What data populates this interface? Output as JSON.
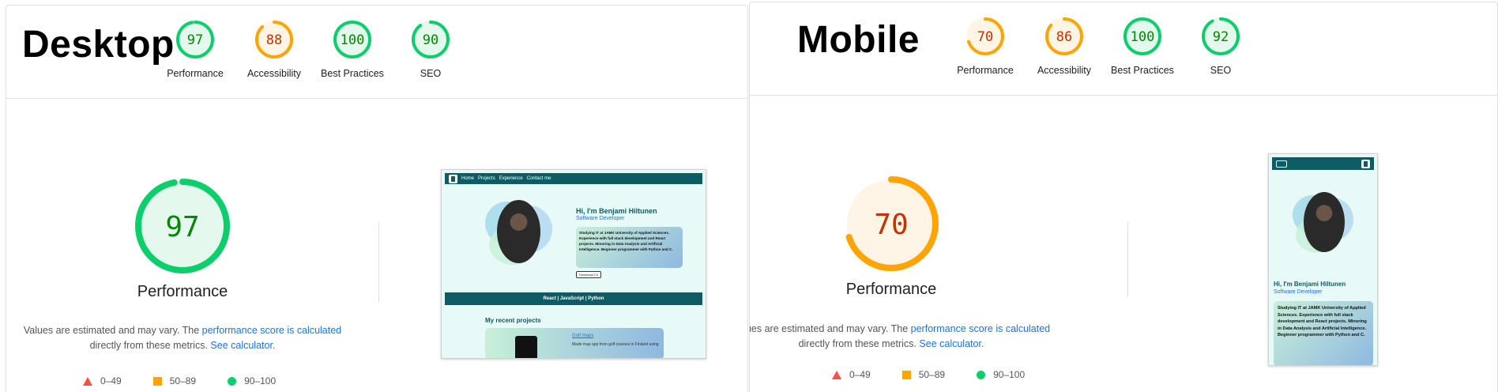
{
  "desktop": {
    "title": "Desktop",
    "scores": [
      {
        "label": "Performance",
        "value": 97,
        "status": "pass"
      },
      {
        "label": "Accessibility",
        "value": 88,
        "status": "average"
      },
      {
        "label": "Best Practices",
        "value": 100,
        "status": "pass"
      },
      {
        "label": "SEO",
        "value": 90,
        "status": "pass"
      }
    ],
    "main_score": {
      "label": "Performance",
      "value": 97
    }
  },
  "mobile": {
    "title": "Mobile",
    "scores": [
      {
        "label": "Performance",
        "value": 70,
        "status": "average"
      },
      {
        "label": "Accessibility",
        "value": 86,
        "status": "average"
      },
      {
        "label": "Best Practices",
        "value": 100,
        "status": "pass"
      },
      {
        "label": "SEO",
        "value": 92,
        "status": "pass"
      }
    ],
    "main_score": {
      "label": "Performance",
      "value": 70
    }
  },
  "note": {
    "text_before": "Values are estimated and may vary. The ",
    "link1": "performance score is calculated",
    "text_middle": "directly from these metrics. ",
    "link2": "See calculator."
  },
  "legend": {
    "fail": "0–49",
    "average": "50–89",
    "pass": "90–100"
  },
  "colors": {
    "pass": "#0cce6b",
    "pass_text": "#008800",
    "pass_bg": "#e5f8ee",
    "average": "#ffa400",
    "average_text": "#c33300",
    "average_bg": "#fff5e6",
    "fail": "#ff4e42"
  },
  "site_preview": {
    "nav_links": [
      "Home",
      "Projects",
      "Experience",
      "Contact me"
    ],
    "name": "Hi, I'm Benjami Hiltunen",
    "role": "Software Developer",
    "bio": "Studying IT at JAMK University of Applied Sciences. Experience with full stack development and React projects. Minoring in Data Analysis and Artificial Intelligence. Beginner programmer with Python and C.",
    "download": "Download CV",
    "tech": "React | JavaScript | Python",
    "recent": "My recent projects",
    "project_title": "Golf maps",
    "project_text": "Made map app from golf courses in Finland using"
  }
}
